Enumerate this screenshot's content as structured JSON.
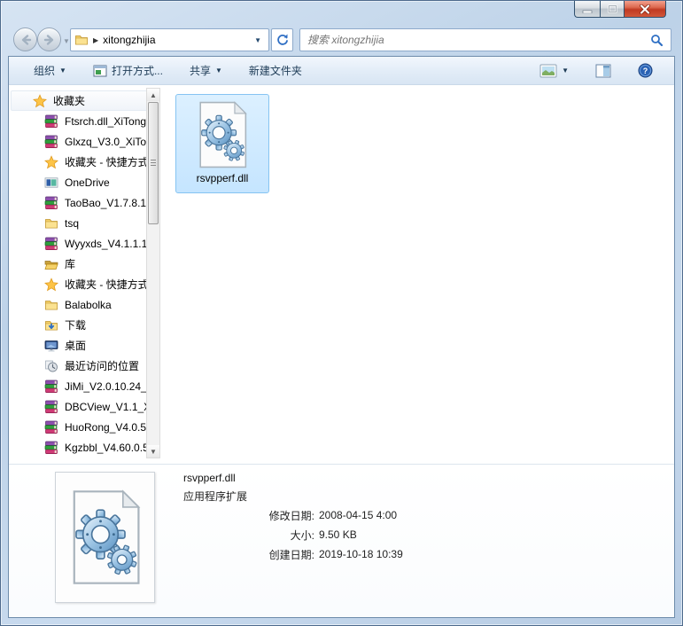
{
  "window": {
    "title": ""
  },
  "navbar": {
    "address_path": "xitongzhijia",
    "search_placeholder": "搜索 xitongzhijia"
  },
  "toolbar": {
    "organize": "组织",
    "open_with": "打开方式...",
    "share": "共享",
    "new_folder": "新建文件夹"
  },
  "sidebar": {
    "items": [
      {
        "icon": "star",
        "label": "收藏夹",
        "header": true
      },
      {
        "icon": "rar",
        "label": "Ftsrch.dll_XiTong"
      },
      {
        "icon": "rar",
        "label": "Glxzq_V3.0_XiTo"
      },
      {
        "icon": "star",
        "label": "收藏夹 - 快捷方式"
      },
      {
        "icon": "onedrive",
        "label": "OneDrive"
      },
      {
        "icon": "rar",
        "label": "TaoBao_V1.7.8.1"
      },
      {
        "icon": "folder",
        "label": "tsq"
      },
      {
        "icon": "rar",
        "label": "Wyyxds_V4.1.1.1"
      },
      {
        "icon": "library",
        "label": "库"
      },
      {
        "icon": "star",
        "label": "收藏夹 - 快捷方式"
      },
      {
        "icon": "folder",
        "label": "Balabolka"
      },
      {
        "icon": "download",
        "label": "下载"
      },
      {
        "icon": "desktop",
        "label": "桌面"
      },
      {
        "icon": "recent",
        "label": "最近访问的位置"
      },
      {
        "icon": "rar",
        "label": "JiMi_V2.0.10.24_"
      },
      {
        "icon": "rar",
        "label": "DBCView_V1.1_X"
      },
      {
        "icon": "rar",
        "label": "HuoRong_V4.0.5"
      },
      {
        "icon": "rar",
        "label": "Kgzbbl_V4.60.0.5"
      }
    ]
  },
  "content": {
    "file_name": "rsvpperf.dll"
  },
  "details": {
    "name": "rsvpperf.dll",
    "type": "应用程序扩展",
    "rows": [
      {
        "label": "修改日期:",
        "value": "2008-04-15 4:00"
      },
      {
        "label": "大小:",
        "value": "9.50 KB"
      },
      {
        "label": "创建日期:",
        "value": "2019-10-18 10:39"
      }
    ]
  },
  "colors": {
    "selection_fill": "#cfe8fc",
    "selection_border": "#86c4f2",
    "close_button_red": "#c03a22",
    "accent_blue": "#2f6fc4"
  }
}
